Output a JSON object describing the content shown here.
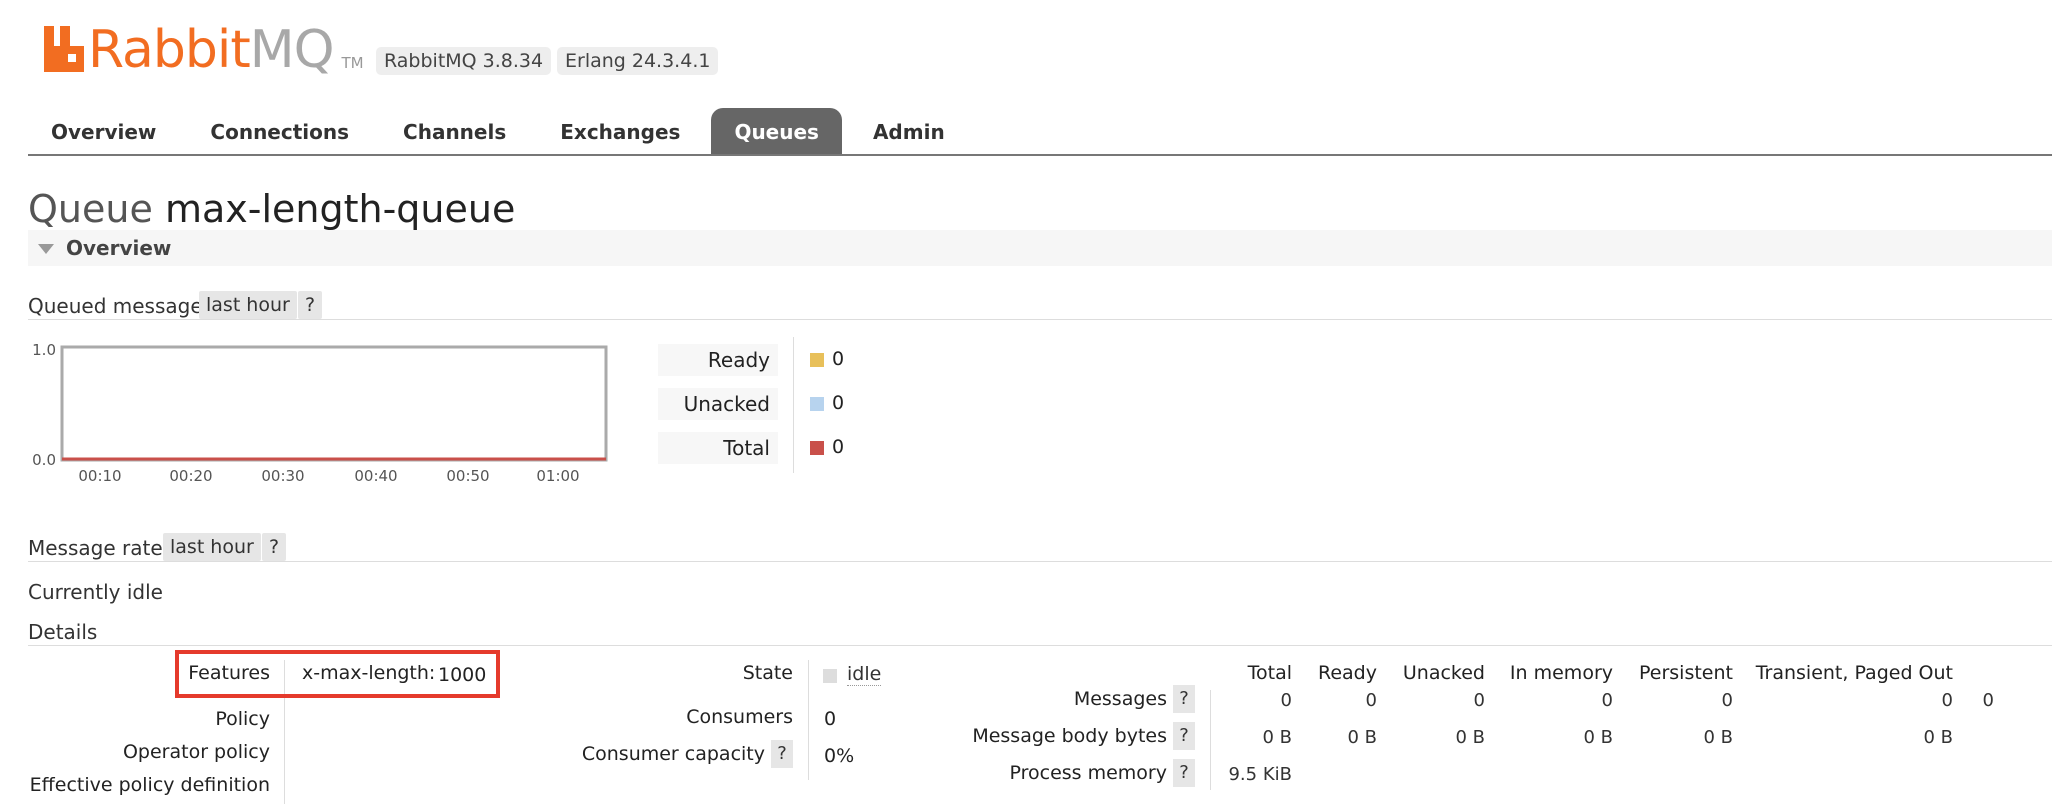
{
  "brand": {
    "rabbit": "Rabbit",
    "mq": "MQ",
    "tm": "TM",
    "accent": "#f26d21"
  },
  "versions": {
    "rabbitmq": "RabbitMQ 3.8.34",
    "erlang": "Erlang 24.3.4.1"
  },
  "tabs": [
    "Overview",
    "Connections",
    "Channels",
    "Exchanges",
    "Queues",
    "Admin"
  ],
  "active_tab": "Queues",
  "title": {
    "prefix": "Queue",
    "name": "max-length-queue"
  },
  "section": {
    "overview": "Overview"
  },
  "queued_messages": {
    "label": "Queued messages",
    "range": "last hour",
    "help": "?",
    "chart": {
      "y_ticks": [
        "1.0",
        "0.0"
      ],
      "x_ticks": [
        "00:10",
        "00:20",
        "00:30",
        "00:40",
        "00:50",
        "01:00"
      ],
      "line_color": "#c9504a"
    },
    "legend": [
      {
        "label": "Ready",
        "value": "0",
        "color": "#e8c05a"
      },
      {
        "label": "Unacked",
        "value": "0",
        "color": "#b7d3ee"
      },
      {
        "label": "Total",
        "value": "0",
        "color": "#c9504a"
      }
    ]
  },
  "message_rates": {
    "label": "Message rates",
    "range": "last hour",
    "help": "?"
  },
  "currently_idle": "Currently idle",
  "details": {
    "title": "Details",
    "features_label": "Features",
    "features_key": "x-max-length:",
    "features_value": "1000",
    "policy_label": "Policy",
    "operator_policy_label": "Operator policy",
    "effective_policy_label": "Effective policy definition",
    "state_label": "State",
    "state_value": "idle",
    "consumers_label": "Consumers",
    "consumers_value": "0",
    "capacity_label": "Consumer capacity",
    "capacity_help": "?",
    "capacity_value": "0%"
  },
  "stats": {
    "columns": [
      "Total",
      "Ready",
      "Unacked",
      "In memory",
      "Persistent",
      "Transient, Paged Out"
    ],
    "help": "?",
    "rows": [
      {
        "label": "Messages",
        "values": [
          "0",
          "0",
          "0",
          "0",
          "0",
          "0"
        ],
        "extra": "0"
      },
      {
        "label": "Message body bytes",
        "values": [
          "0 B",
          "0 B",
          "0 B",
          "0 B",
          "0 B",
          "0 B"
        ]
      },
      {
        "label": "Process memory",
        "values": [
          "9.5 KiB"
        ]
      }
    ]
  }
}
